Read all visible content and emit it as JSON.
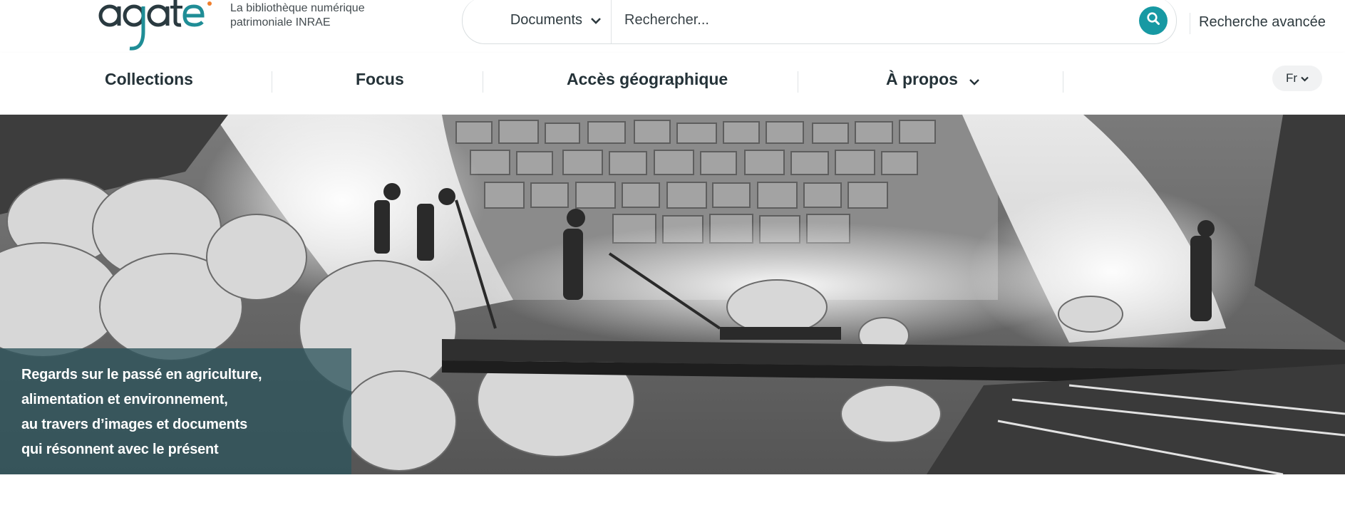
{
  "header": {
    "logo_text": "agate",
    "tagline_line1": "La bibliothèque numérique",
    "tagline_line2": "patrimoniale INRAE",
    "search": {
      "scope_label": "Documents",
      "placeholder": "Rechercher...",
      "search_icon": "search-icon"
    },
    "advanced_search_label": "Recherche avancée"
  },
  "nav": {
    "items": [
      {
        "label": "Collections"
      },
      {
        "label": "Focus"
      },
      {
        "label": "Accès géographique"
      },
      {
        "label": "À propos",
        "has_dropdown": true
      }
    ],
    "language": "Fr"
  },
  "hero": {
    "image_desc": "black-and-white historic photograph",
    "caption_lines": [
      "Regards sur le passé en agriculture,",
      "alimentation et environnement,",
      "au travers d’images et documents",
      "qui résonnent avec le présent"
    ],
    "caption_bg": "#2e545c"
  },
  "colors": {
    "accent": "#1799a3",
    "logo_teal": "#1f8d96",
    "logo_orange": "#f07f2d",
    "text_dark": "#243238"
  }
}
